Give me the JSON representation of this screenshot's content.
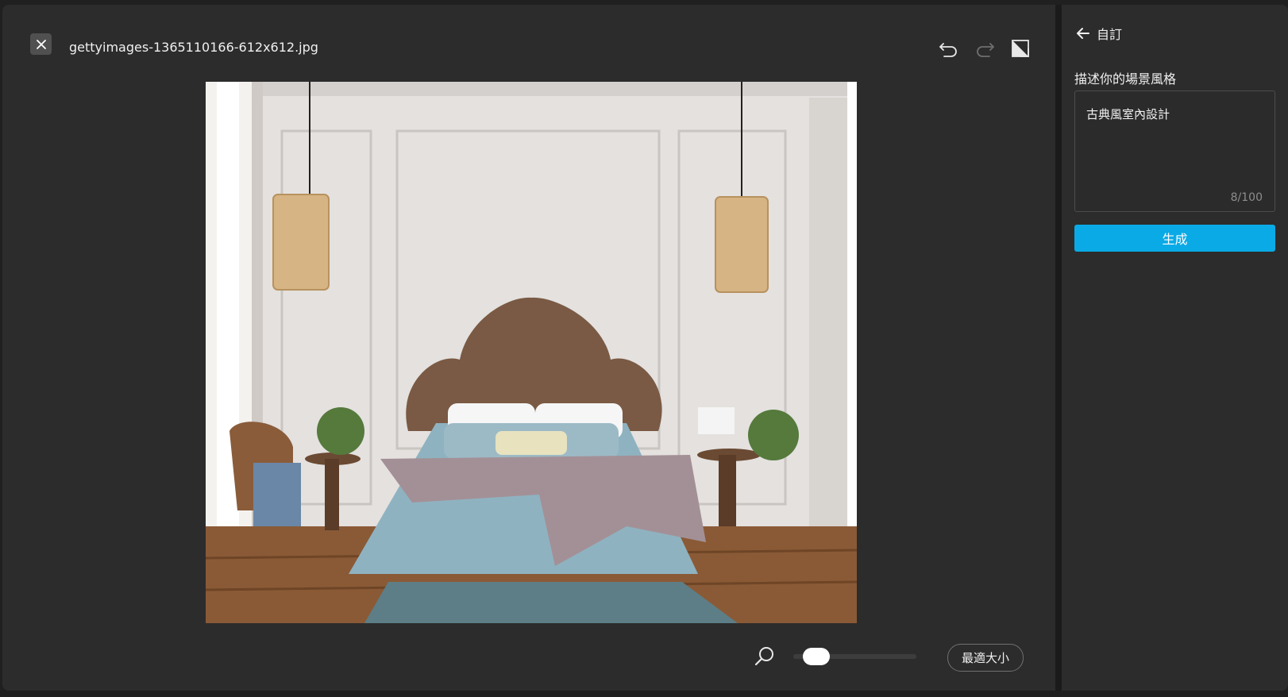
{
  "header": {
    "filename": "gettyimages-1365110166-612x612.jpg"
  },
  "toolbar": {
    "undo": "undo-icon",
    "redo": "redo-icon",
    "compare": "compare-icon"
  },
  "image": {
    "description_icon": "bedroom-photo"
  },
  "zoom": {
    "level": 0.1,
    "fit_label": "最適大小"
  },
  "panel": {
    "back_label": "自訂",
    "prompt_label": "描述你的場景風格",
    "prompt_value": "古典風室內設計",
    "char_count": "8/100",
    "generate_label": "生成"
  },
  "colors": {
    "accent": "#0aaae6",
    "background": "#2c2c2c"
  }
}
